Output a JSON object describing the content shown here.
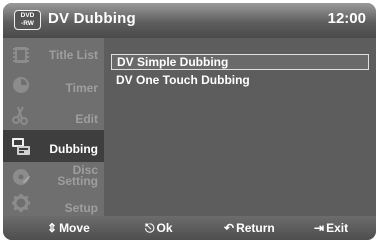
{
  "header": {
    "badge_line1": "DVD",
    "badge_line2": "-RW",
    "title": "DV Dubbing",
    "time": "12:00"
  },
  "sidebar": {
    "items": [
      {
        "label": "Title List",
        "icon": "film-icon"
      },
      {
        "label": "Timer",
        "icon": "clock-icon"
      },
      {
        "label": "Edit",
        "icon": "scissors-icon"
      },
      {
        "label": "Dubbing",
        "icon": "dubbing-icon",
        "active": true
      },
      {
        "label_line1": "Disc",
        "label_line2": "Setting",
        "icon": "disc-icon"
      },
      {
        "label": "Setup",
        "icon": "gear-icon"
      }
    ]
  },
  "menu": {
    "items": [
      {
        "label": "DV Simple Dubbing",
        "selected": true
      },
      {
        "label": "DV One Touch Dubbing",
        "selected": false
      }
    ]
  },
  "footer": {
    "move": "Move",
    "ok": "Ok",
    "return": "Return",
    "exit": "Exit"
  },
  "colors": {
    "header": "#5e5e5e",
    "sidebar": "#6f6f6f",
    "sidebar_active": "#3e3e3e",
    "content": "#5d5d5d",
    "inactive_text": "#9e9e9e"
  }
}
